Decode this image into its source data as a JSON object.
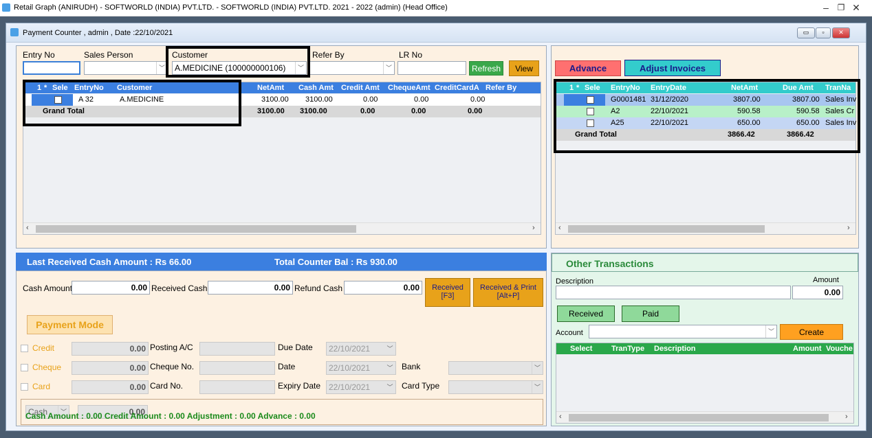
{
  "window": {
    "title": "Retail Graph (ANIRUDH) - SOFTWORLD (INDIA) PVT.LTD. - SOFTWORLD (INDIA) PVT.LTD.  2021 - 2022 (admin) (Head Office)",
    "minimize": "–",
    "restore": "❐",
    "close": "✕"
  },
  "form": {
    "title": "Payment Counter , admin , Date :22/10/2021"
  },
  "top": {
    "entry_no_label": "Entry No",
    "entry_no_value": "",
    "sales_person_label": "Sales Person",
    "sales_person_value": "",
    "customer_label": "Customer",
    "customer_value": "A.MEDICINE (100000000106)",
    "refer_by_label": "Refer By",
    "refer_by_value": "",
    "lr_no_label": "LR No",
    "lr_no_value": "",
    "refresh": "Refresh",
    "view": "View"
  },
  "left_grid": {
    "headers": [
      "1",
      "*",
      "Sele",
      "EntryNo",
      "Customer",
      "NetAmt",
      "Cash Amt",
      "Credit Amt",
      "ChequeAmt",
      "CreditCardA",
      "Refer By"
    ],
    "row": {
      "entry": "A 32",
      "customer": "A.MEDICINE",
      "net": "3100.00",
      "cash": "3100.00",
      "credit": "0.00",
      "cheque": "0.00",
      "card": "0.00"
    },
    "total": {
      "label": "Grand Total",
      "net": "3100.00",
      "cash": "3100.00",
      "credit": "0.00",
      "cheque": "0.00",
      "card": "0.00"
    }
  },
  "right": {
    "advance": "Advance",
    "adjust": "Adjust Invoices",
    "headers": [
      "1",
      "*",
      "Sele",
      "EntryNo",
      "EntryDate",
      "NetAmt",
      "Due Amt",
      "TranNa"
    ],
    "rows": [
      {
        "entry": "G0001481",
        "date": "31/12/2020",
        "net": "3807.00",
        "due": "3807.00",
        "tran": "Sales Inv"
      },
      {
        "entry": "A2",
        "date": "22/10/2021",
        "net": "590.58",
        "due": "590.58",
        "tran": "Sales Cr"
      },
      {
        "entry": "A25",
        "date": "22/10/2021",
        "net": "650.00",
        "due": "650.00",
        "tran": "Sales Inv"
      }
    ],
    "total": {
      "label": "Grand Total",
      "net": "3866.42",
      "due": "3866.42"
    }
  },
  "summary": {
    "last_received": "Last Received Cash Amount : Rs 66.00",
    "counter_bal": "Total Counter Bal : Rs 930.00"
  },
  "payment": {
    "cash_amount_label": "Cash Amount",
    "cash_amount": "0.00",
    "received_cash_label": "Received Cash",
    "received_cash": "0.00",
    "refund_cash_label": "Refund Cash",
    "refund_cash": "0.00",
    "received_btn": "Received\n[F3]",
    "received_print_btn": "Received & Print\n[Alt+P]",
    "mode_title": "Payment Mode",
    "credit_label": "Credit",
    "credit_amt": "0.00",
    "posting_label": "Posting A/C",
    "due_date_label": "Due Date",
    "due_date": "22/10/2021",
    "cheque_label": "Cheque",
    "cheque_amt": "0.00",
    "cheque_no_label": "Cheque No.",
    "date_label": "Date",
    "date": "22/10/2021",
    "bank_label": "Bank",
    "card_label": "Card",
    "card_amt": "0.00",
    "card_no_label": "Card No.",
    "expiry_label": "Expiry Date",
    "expiry": "22/10/2021",
    "card_type_label": "Card Type",
    "cash_mode": "Cash",
    "cash_mode_amt": "0.00",
    "footer": "Cash Amount : 0.00   Credit Amount : 0.00   Adjustment : 0.00   Advance : 0.00"
  },
  "other": {
    "title": "Other Transactions",
    "description_label": "Description",
    "amount_label": "Amount",
    "amount": "0.00",
    "received": "Received",
    "paid": "Paid",
    "account_label": "Account",
    "create": "Create",
    "headers": [
      "Select",
      "TranType",
      "Description",
      "Amount",
      "Vouche"
    ]
  },
  "colors": {
    "grid_header": "#3b7fe0",
    "green_btn": "#3aa84a",
    "orange_btn": "#e8a21a",
    "advance_btn": "#ff7070",
    "adjust_btn": "#33cccc"
  }
}
